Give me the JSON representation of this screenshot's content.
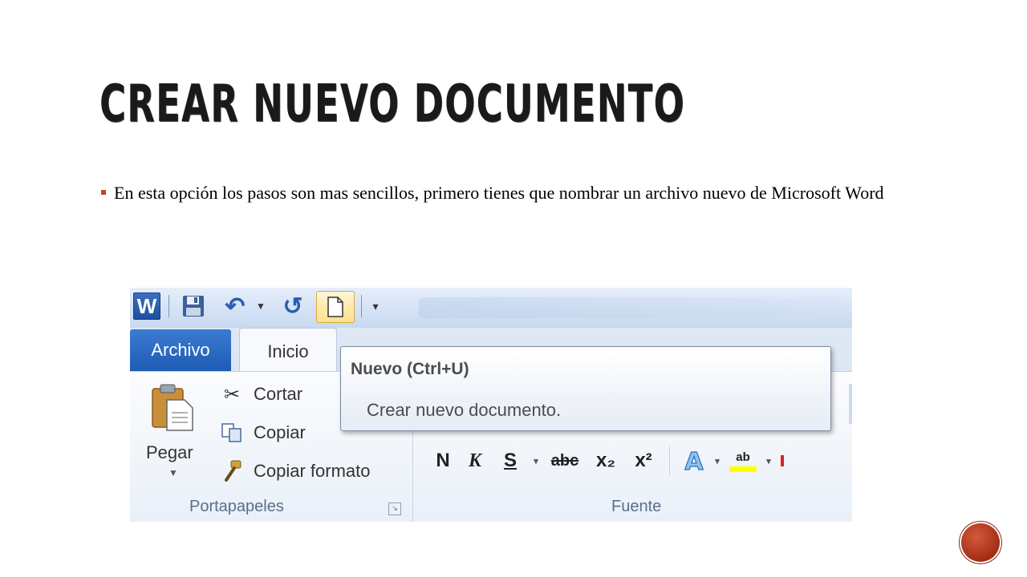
{
  "slide": {
    "title": "CREAR NUEVO DOCUMENTO",
    "bullet": "En esta opción los pasos son mas sencillos, primero tienes que nombrar un archivo nuevo de Microsoft Word"
  },
  "word": {
    "app_icon_letter": "W",
    "tabs": {
      "archivo": "Archivo",
      "inicio": "Inicio"
    },
    "tooltip": {
      "title": "Nuevo (Ctrl+U)",
      "description": "Crear nuevo documento."
    },
    "portapapeles": {
      "paste_label": "Pegar",
      "cut_label": "Cortar",
      "copy_label": "Copiar",
      "format_painter_label": "Copiar formato",
      "group_label": "Portapapeles"
    },
    "fuente": {
      "group_label": "Fuente",
      "bold": "N",
      "italic": "K",
      "underline": "S",
      "strikethrough": "abc",
      "subscript": "x₂",
      "superscript": "x²",
      "highlight_label": "ab"
    }
  },
  "colors": {
    "accent": "#b8452a",
    "archivo_tab": "#2a66c2",
    "highlight_yellow": "#ffff00"
  }
}
